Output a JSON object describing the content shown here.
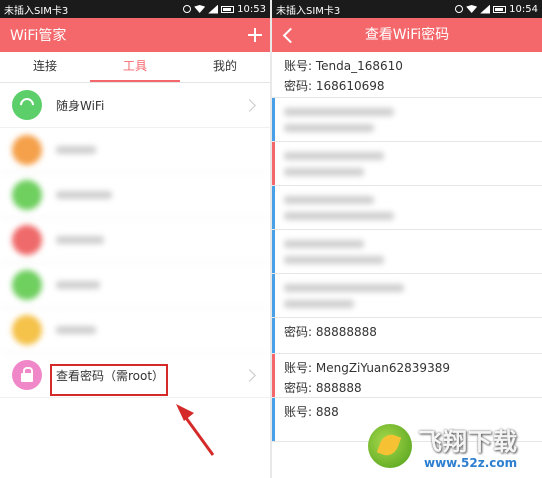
{
  "left_screen": {
    "status_bar": {
      "carrier": "未插入SIM卡3",
      "time": "10:53"
    },
    "app_title": "WiFi管家",
    "tabs": [
      {
        "label": "连接",
        "active": false
      },
      {
        "label": "工具",
        "active": true
      },
      {
        "label": "我的",
        "active": false
      }
    ],
    "tools": [
      {
        "label": "随身WiFi",
        "icon_color": "#5ccf6a",
        "blurred": true
      },
      {
        "label": "",
        "icon_color": "#f5a04a",
        "blurred": true
      },
      {
        "label": "",
        "icon_color": "#6fcf5f",
        "blurred": true
      },
      {
        "label": "",
        "icon_color": "#ef6a6a",
        "blurred": true
      },
      {
        "label": "",
        "icon_color": "#6fcf5f",
        "blurred": true
      },
      {
        "label": "",
        "icon_color": "#f5c24a",
        "blurred": true
      },
      {
        "label": "查看密码（需root）",
        "icon_color": "#ef87c8",
        "blurred": false
      }
    ]
  },
  "right_screen": {
    "status_bar": {
      "carrier": "未插入SIM卡3",
      "time": "10:54"
    },
    "page_title": "查看WiFi密码",
    "entries": [
      {
        "account": "账号: Tenda_168610",
        "password": "密码: 168610698",
        "blurred": false,
        "accent": "none"
      },
      {
        "account": "",
        "password": "",
        "blurred": true,
        "accent": "blue"
      },
      {
        "account": "",
        "password": "",
        "blurred": true,
        "accent": "red"
      },
      {
        "account": "",
        "password": "",
        "blurred": true,
        "accent": "blue"
      },
      {
        "account": "",
        "password": "",
        "blurred": true,
        "accent": "blue"
      },
      {
        "account": "",
        "password": "",
        "blurred": true,
        "accent": "blue"
      },
      {
        "account": "",
        "password": "密码: 88888888",
        "blurred": false,
        "accent": "blue"
      },
      {
        "account": "账号: MengZiYuan62839389",
        "password": "密码: 888888",
        "blurred": false,
        "accent": "red"
      },
      {
        "account": "账号: 888",
        "password": "",
        "blurred": false,
        "accent": "blue"
      }
    ]
  },
  "watermark": {
    "text": "飞翔下载",
    "url": "www.52z.com"
  },
  "colors": {
    "header": "#f4676b",
    "highlight": "#d42a2a",
    "accent_blue": "#4aa0e6"
  }
}
